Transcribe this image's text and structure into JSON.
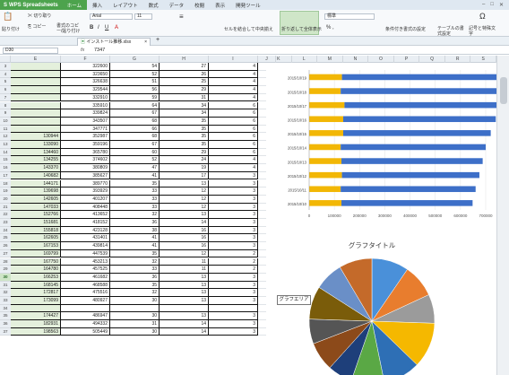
{
  "app": {
    "name": "WPS Spreadsheets",
    "menu": [
      "ホーム",
      "挿入",
      "レイアウト",
      "数式",
      "データ",
      "校閲",
      "表示",
      "開発ツール"
    ]
  },
  "ribbon": {
    "paste": "貼り付け",
    "cut": "切り取り",
    "copy": "コピー",
    "format_copy": "書式のコピー/貼り付け",
    "font_name": "Arial",
    "font_size": "11",
    "merge": "セルを結合して中央揃え",
    "wrap": "折り返して全体表示",
    "number_format": "標準",
    "cond_format": "条件付き書式の設定",
    "table_format": "テーブルの書式設定",
    "symbols": "記号と特殊文字"
  },
  "document": {
    "tab": "インストール推移.xlsx"
  },
  "formula_bar": {
    "name_box": "D30",
    "fx": "fx",
    "value": "7347"
  },
  "columns": [
    "E",
    "F",
    "G",
    "H",
    "I",
    "J",
    "K",
    "L",
    "M",
    "N",
    "O",
    "P",
    "Q",
    "R",
    "S"
  ],
  "sheet": {
    "start_row": 3,
    "selected_row": 30,
    "rows": [
      [
        "",
        "322600",
        "54",
        "27",
        "4"
      ],
      [
        "",
        "323650",
        "52",
        "26",
        "4"
      ],
      [
        "",
        "326638",
        "51",
        "25",
        "4"
      ],
      [
        "",
        "329544",
        "56",
        "29",
        "4"
      ],
      [
        "",
        "332910",
        "59",
        "31",
        "4"
      ],
      [
        "",
        "335910",
        "64",
        "34",
        "6"
      ],
      [
        "",
        "339824",
        "67",
        "34",
        "6"
      ],
      [
        "",
        "343507",
        "68",
        "35",
        "6"
      ],
      [
        "",
        "347771",
        "66",
        "35",
        "6"
      ],
      [
        "130944",
        "352987",
        "68",
        "35",
        "6"
      ],
      [
        "133090",
        "359196",
        "67",
        "35",
        "6"
      ],
      [
        "134460",
        "365780",
        "60",
        "29",
        "6"
      ],
      [
        "134255",
        "374602",
        "52",
        "24",
        "4"
      ],
      [
        "143370",
        "380809",
        "47",
        "19",
        "4"
      ],
      [
        "140682",
        "385627",
        "41",
        "17",
        "3"
      ],
      [
        "144171",
        "389770",
        "35",
        "13",
        "3"
      ],
      [
        "139698",
        "393929",
        "33",
        "12",
        "3"
      ],
      [
        "142605",
        "401207",
        "33",
        "12",
        "3"
      ],
      [
        "147033",
        "408448",
        "33",
        "12",
        "3"
      ],
      [
        "152766",
        "413652",
        "32",
        "13",
        "3"
      ],
      [
        "151681",
        "418152",
        "36",
        "14",
        "3"
      ],
      [
        "155818",
        "423128",
        "38",
        "16",
        "3"
      ],
      [
        "162605",
        "431401",
        "41",
        "16",
        "3"
      ],
      [
        "167153",
        "439814",
        "41",
        "16",
        "3"
      ],
      [
        "169799",
        "447539",
        "35",
        "12",
        "2"
      ],
      [
        "167750",
        "453213",
        "32",
        "11",
        "2"
      ],
      [
        "164780",
        "457525",
        "33",
        "11",
        "2"
      ],
      [
        "166253",
        "461682",
        "36",
        "13",
        "3"
      ],
      [
        "168145",
        "468588",
        "35",
        "13",
        "3"
      ],
      [
        "172817",
        "475516",
        "32",
        "13",
        "3"
      ],
      [
        "173099",
        "480927",
        "30",
        "13",
        "3"
      ],
      [
        "",
        "",
        "",
        "",
        ""
      ],
      [
        "174427",
        "486947",
        "30",
        "13",
        "3"
      ],
      [
        "182931",
        "494332",
        "31",
        "14",
        "3"
      ],
      [
        "198563",
        "505449",
        "30",
        "14",
        "3"
      ]
    ]
  },
  "chart_data": [
    {
      "type": "bar",
      "orientation": "horizontal",
      "stacked": true,
      "categories": [
        "2015/10/19",
        "2015/10/18",
        "2015/10/17",
        "2015/10/16",
        "2015/10/15",
        "2015/10/14",
        "2015/10/13",
        "2015/10/12",
        "2015/10/11",
        "2015/10/10"
      ],
      "series": [
        {
          "values": [
            130000,
            125000,
            140000,
            135000,
            135000,
            125000,
            128000,
            130000,
            125000,
            128000
          ]
        },
        {
          "values": [
            650000,
            640000,
            630000,
            605000,
            585000,
            575000,
            560000,
            545000,
            535000,
            520000
          ]
        }
      ],
      "colors": [
        "#f2b705",
        "#3d6fc8"
      ],
      "xticks": [
        "0",
        "100000",
        "200000",
        "300000",
        "400000",
        "500000",
        "600000",
        "700000"
      ],
      "xlim": [
        0,
        700000
      ],
      "grid": true
    },
    {
      "type": "pie",
      "title": "グラフタイトル",
      "values": [
        9,
        8,
        7,
        11,
        9,
        8,
        6,
        7,
        6,
        8,
        7,
        8
      ],
      "colors": [
        "#4a90d9",
        "#e87d2e",
        "#9b9b9b",
        "#f5b800",
        "#2e6fb5",
        "#5aa845",
        "#1e3f7a",
        "#8c4a1a",
        "#555555",
        "#7a5c0a",
        "#6a8fc7",
        "#c46a2a"
      ]
    }
  ],
  "chart_panel": {
    "tooltip": "グラフエリア"
  }
}
